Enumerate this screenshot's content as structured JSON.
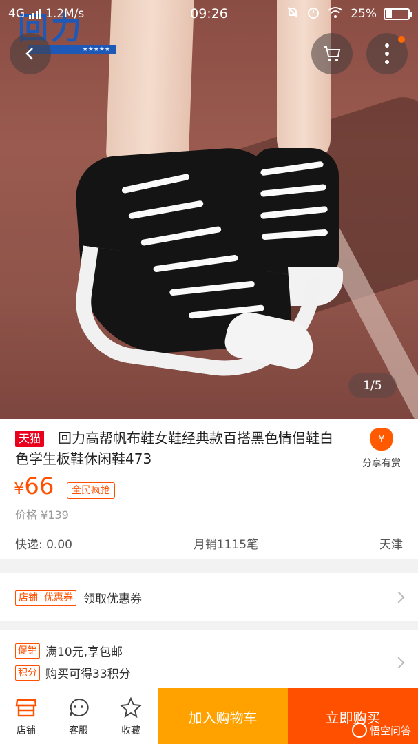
{
  "status_bar": {
    "network": "4G",
    "speed": "1.2M/s",
    "time": "09:26",
    "battery": "25%",
    "battery_level": 0.25
  },
  "brand_logo_text": "回力",
  "hero": {
    "page_indicator": "1/5"
  },
  "product": {
    "badge": "天猫",
    "title": "回力高帮帆布鞋女鞋经典款百搭黑色情侣鞋白色学生板鞋休闲鞋473",
    "share_label": "分享有赏",
    "share_icon_text": "¥",
    "price_symbol": "¥",
    "price": "66",
    "promo_tag": "全民疯抢",
    "original_label": "价格",
    "original_price": "¥139",
    "shipping": "快递: 0.00",
    "monthly_sales": "月销1115笔",
    "location": "天津"
  },
  "coupon_row": {
    "chip_a": "店铺",
    "chip_b": "优惠券",
    "text": "领取优惠券"
  },
  "promo_row": {
    "chip_promo": "促销",
    "promo_text": "满10元,享包邮",
    "chip_points": "积分",
    "points_text": "购买可得33积分"
  },
  "bottom_bar": {
    "shop": "店铺",
    "service": "客服",
    "favorite": "收藏",
    "add_to_cart": "加入购物车",
    "buy_now": "立即购买"
  },
  "watermark": "悟空问答",
  "colors": {
    "accent": "#ff5000",
    "cart_button": "#ffa200",
    "tmall": "#e8001c"
  }
}
